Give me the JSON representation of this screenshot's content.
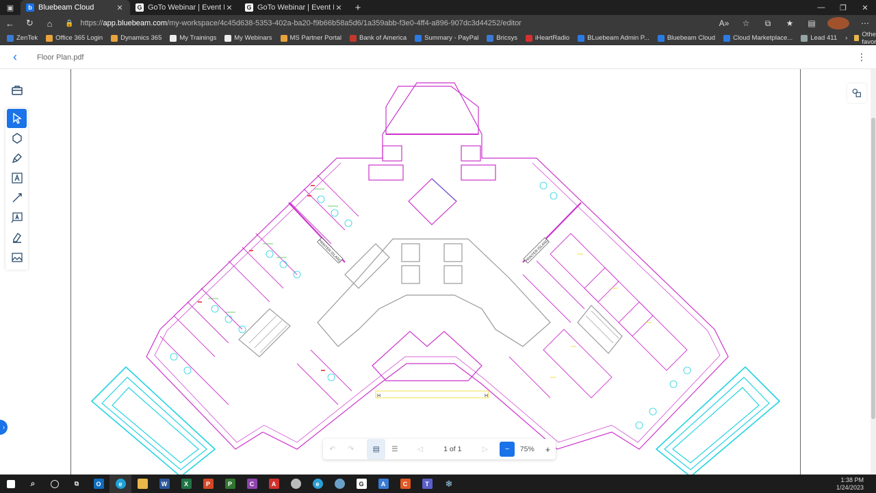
{
  "browser": {
    "tabs": [
      {
        "title": "Bluebeam Cloud",
        "icon": "bluebeam-icon",
        "active": true
      },
      {
        "title": "GoTo Webinar | Event Details",
        "icon": "goto-icon",
        "active": false
      },
      {
        "title": "GoTo Webinar | Event Details",
        "icon": "goto-icon",
        "active": false
      }
    ],
    "url_prefix": "https://",
    "url_host": "app.bluebeam.com",
    "url_path": "/my-workspace/4c45d638-5353-402a-ba20-f9b66b58a5d6/1a359abb-f3e0-4ff4-a896-907dc3d44252/editor",
    "bookmarks": [
      {
        "label": "ZenTek",
        "color": "#3a7bd5"
      },
      {
        "label": "Office 365 Login",
        "color": "#e8a33d"
      },
      {
        "label": "Dynamics 365",
        "color": "#e8a33d"
      },
      {
        "label": "My Trainings",
        "color": "#eeeeee"
      },
      {
        "label": "My Webinars",
        "color": "#eeeeee"
      },
      {
        "label": "MS Partner Portal",
        "color": "#e8a33d"
      },
      {
        "label": "Bank of America",
        "color": "#c0392b"
      },
      {
        "label": "Summary - PayPal",
        "color": "#2c7be5"
      },
      {
        "label": "Bricsys",
        "color": "#3a7bd5"
      },
      {
        "label": "iHeartRadio",
        "color": "#d63031"
      },
      {
        "label": "BLuebeam Admin P...",
        "color": "#2c7be5"
      },
      {
        "label": "Bluebeam Cloud",
        "color": "#2c7be5"
      },
      {
        "label": "Cloud Marketplace...",
        "color": "#2c7be5"
      },
      {
        "label": "Lead 411",
        "color": "#95a5a6"
      }
    ],
    "other_favorites": "Other favorites"
  },
  "app": {
    "document_title": "Floor Plan.pdf",
    "page_indicator": "1 of 1",
    "zoom": "75%"
  },
  "colors": {
    "accent": "#1a73e8",
    "plan_magenta": "#cc33cc",
    "plan_cyan": "#22d3e0",
    "plan_yellow": "#f2e46b",
    "plan_green": "#3cbf3c",
    "plan_gray": "#9a9a9a",
    "plan_red": "#e02020"
  },
  "plan_labels": {
    "left_island": "PRINTER ISLAND",
    "right_island": "PRINTER ISLAND",
    "stair_h_left": "H",
    "stair_h_right": "H"
  },
  "taskbar": {
    "time": "1:38 PM",
    "date": "1/24/2023"
  }
}
